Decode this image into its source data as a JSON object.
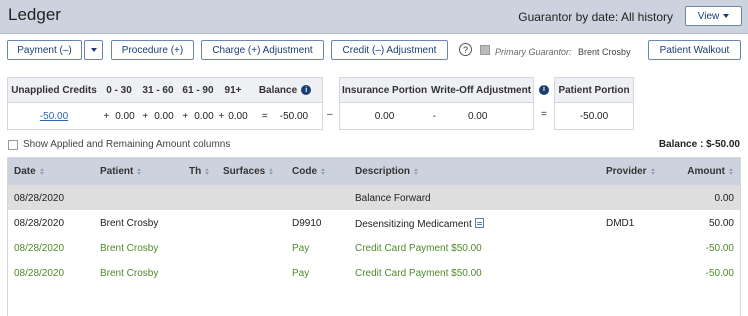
{
  "header": {
    "title": "Ledger",
    "guarantor_label": "Guarantor by date: All history",
    "view_label": "View"
  },
  "toolbar": {
    "payment_label": "Payment (–)",
    "procedure_label": "Procedure (+)",
    "charge_label": "Charge (+) Adjustment",
    "credit_label": "Credit (–) Adjustment",
    "help_glyph": "?",
    "primary_guarantor_label": "Primary Guarantor:",
    "primary_guarantor_name": "Brent Crosby",
    "walkout_label": "Patient Walkout"
  },
  "summary": {
    "headers": {
      "unapplied": "Unapplied Credits",
      "d0_30": "0 - 30",
      "d31_60": "31 - 60",
      "d61_90": "61 - 90",
      "d91": "91+",
      "balance": "Balance",
      "insurance": "Insurance Portion",
      "writeoff": "Write-Off Adjustment",
      "patient": "Patient Portion"
    },
    "values": {
      "unapplied": "-50.00",
      "d0_30": "0.00",
      "d31_60": "0.00",
      "d61_90": "0.00",
      "d91": "0.00",
      "balance": "-50.00",
      "insurance": "0.00",
      "writeoff": "0.00",
      "patient": "-50.00"
    },
    "ops": {
      "plus": "+",
      "equals": "=",
      "minus": "–",
      "dash": "-"
    }
  },
  "show_applied_label": "Show Applied and Remaining Amount columns",
  "balance_total": "Balance : $-50.00",
  "table": {
    "headers": {
      "date": "Date",
      "patient": "Patient",
      "th": "Th",
      "surfaces": "Surfaces",
      "code": "Code",
      "description": "Description",
      "provider": "Provider",
      "amount": "Amount"
    },
    "rows": [
      {
        "date": "08/28/2020",
        "patient": "",
        "code": "",
        "description": "Balance Forward",
        "provider": "",
        "amount": "0.00"
      },
      {
        "date": "08/28/2020",
        "patient": "Brent Crosby",
        "code": "D9910",
        "description": "Desensitizing Medicament",
        "provider": "DMD1",
        "amount": "50.00"
      },
      {
        "date": "08/28/2020",
        "patient": "Brent Crosby",
        "code": "Pay",
        "description": "Credit Card Payment $50.00",
        "provider": "",
        "amount": "-50.00"
      },
      {
        "date": "08/28/2020",
        "patient": "Brent Crosby",
        "code": "Pay",
        "description": "Credit Card Payment $50.00",
        "provider": "",
        "amount": "-50.00"
      }
    ]
  },
  "colors": {
    "header_bg": "#ccd3de",
    "accent": "#1a3e73",
    "payment_green": "#4e8a2a",
    "link_blue": "#2b66b5"
  }
}
